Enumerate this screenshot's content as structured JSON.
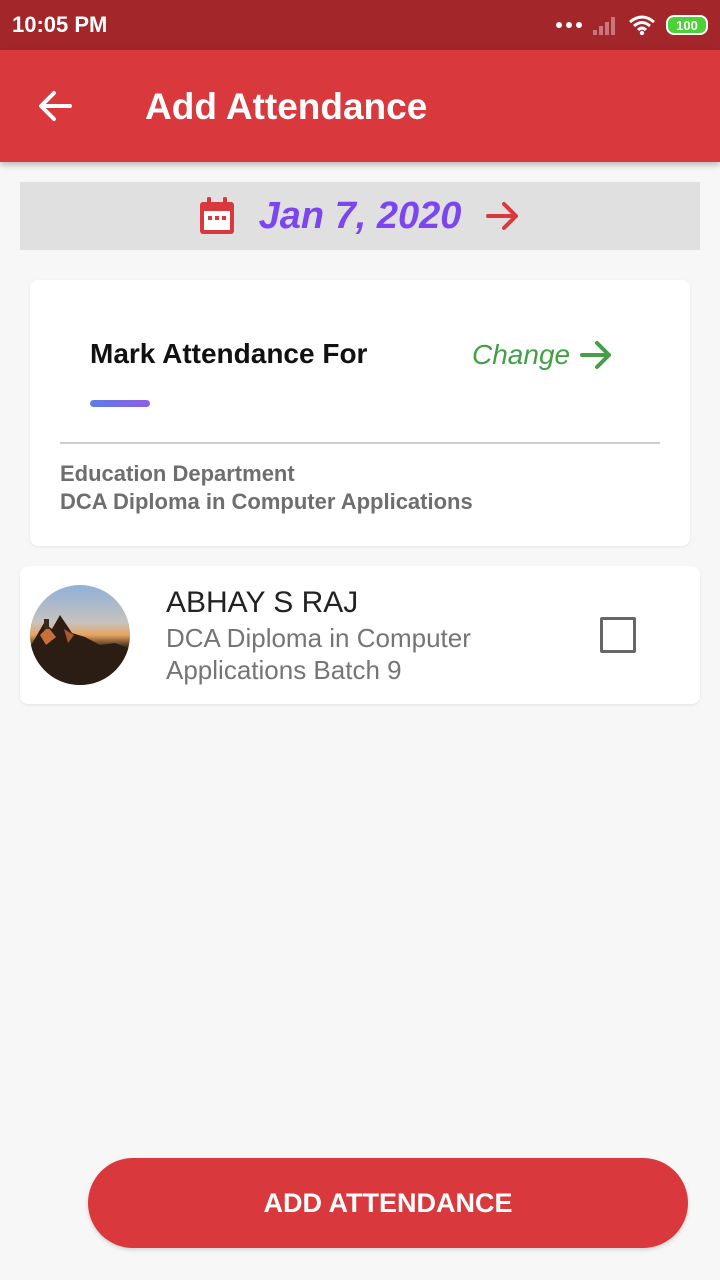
{
  "status_bar": {
    "time": "10:05 PM",
    "battery": "100"
  },
  "app_bar": {
    "title": "Add Attendance",
    "back_icon": "arrow-left-icon"
  },
  "date_bar": {
    "date": "Jan 7, 2020",
    "calendar_icon": "calendar-icon",
    "next_icon": "arrow-right-icon"
  },
  "mark_card": {
    "title": "Mark Attendance For",
    "change_label": "Change",
    "department": "Education Department",
    "course": "DCA  Diploma in Computer Applications"
  },
  "students": [
    {
      "name": "ABHAY S RAJ",
      "course": "DCA  Diploma in Computer Applications Batch 9",
      "checked": false
    }
  ],
  "action": {
    "label": "ADD ATTENDANCE"
  },
  "colors": {
    "status_bar": "#a3262a",
    "app_bar": "#d9383c",
    "date_text": "#7b46f0",
    "change_text": "#43a047",
    "button": "#d9383c"
  }
}
